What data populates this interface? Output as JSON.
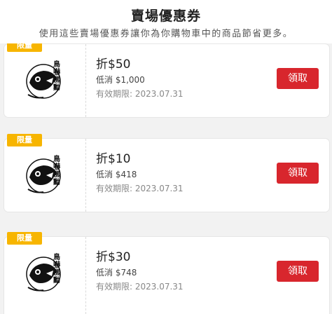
{
  "header": {
    "title": "賣場優惠券",
    "subtitle": "使用這些賣場優惠券讓你為你購物車中的商品節省更多。"
  },
  "coupons": [
    {
      "badge": "限量",
      "logo_text": "鳥嚇糕勳",
      "discount": "折$50",
      "min_spend": "低消 $1,000",
      "validity": "有效期限: 2023.07.31",
      "claim_label": "領取"
    },
    {
      "badge": "限量",
      "logo_text": "鳥嚇糕勳",
      "discount": "折$10",
      "min_spend": "低消 $418",
      "validity": "有效期限: 2023.07.31",
      "claim_label": "領取"
    },
    {
      "badge": "限量",
      "logo_text": "鳥嚇糕勳",
      "discount": "折$30",
      "min_spend": "低消 $748",
      "validity": "有效期限: 2023.07.31",
      "claim_label": "領取"
    }
  ],
  "colors": {
    "claim_button": "#d8262d",
    "badge": "#f7b500",
    "background": "#f2f2f2"
  }
}
